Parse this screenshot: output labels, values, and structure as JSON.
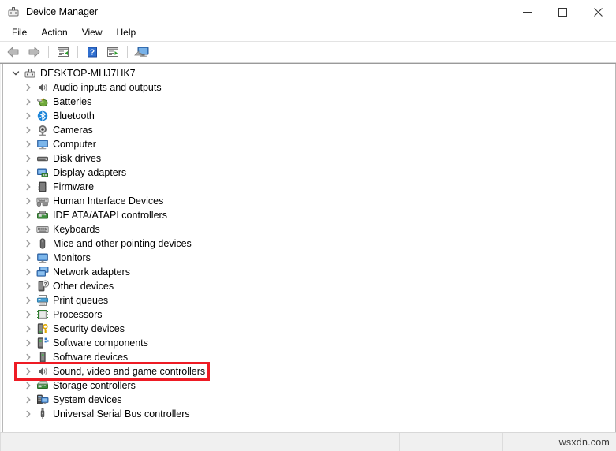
{
  "window": {
    "title": "Device Manager",
    "title_icon": "device-manager-icon",
    "controls": {
      "minimize": "minimize-icon",
      "maximize": "maximize-icon",
      "close": "close-icon"
    }
  },
  "menubar": {
    "items": [
      {
        "label": "File",
        "name": "menu-file"
      },
      {
        "label": "Action",
        "name": "menu-action"
      },
      {
        "label": "View",
        "name": "menu-view"
      },
      {
        "label": "Help",
        "name": "menu-help"
      }
    ]
  },
  "toolbar": {
    "buttons": [
      {
        "name": "back-button",
        "icon": "back-arrow-icon"
      },
      {
        "name": "forward-button",
        "icon": "forward-arrow-icon"
      },
      {
        "name": "properties-button",
        "icon": "properties-icon"
      },
      {
        "name": "help-button",
        "icon": "help-icon"
      },
      {
        "name": "update-driver-button",
        "icon": "update-driver-icon"
      },
      {
        "name": "scan-hardware-changes-button",
        "icon": "scan-hardware-icon"
      }
    ]
  },
  "tree": {
    "root": {
      "label": "DESKTOP-MHJ7HK7",
      "icon": "computer-root-icon",
      "expanded": true
    },
    "items": [
      {
        "label": "Audio inputs and outputs",
        "icon": "speaker-icon"
      },
      {
        "label": "Batteries",
        "icon": "battery-icon"
      },
      {
        "label": "Bluetooth",
        "icon": "bluetooth-icon"
      },
      {
        "label": "Cameras",
        "icon": "camera-icon"
      },
      {
        "label": "Computer",
        "icon": "monitor-icon"
      },
      {
        "label": "Disk drives",
        "icon": "disk-drive-icon"
      },
      {
        "label": "Display adapters",
        "icon": "display-adapter-icon"
      },
      {
        "label": "Firmware",
        "icon": "firmware-chip-icon"
      },
      {
        "label": "Human Interface Devices",
        "icon": "hid-icon"
      },
      {
        "label": "IDE ATA/ATAPI controllers",
        "icon": "ide-controller-icon"
      },
      {
        "label": "Keyboards",
        "icon": "keyboard-icon"
      },
      {
        "label": "Mice and other pointing devices",
        "icon": "mouse-icon"
      },
      {
        "label": "Monitors",
        "icon": "monitor-icon"
      },
      {
        "label": "Network adapters",
        "icon": "network-adapter-icon"
      },
      {
        "label": "Other devices",
        "icon": "other-device-icon"
      },
      {
        "label": "Print queues",
        "icon": "printer-icon"
      },
      {
        "label": "Processors",
        "icon": "processor-icon"
      },
      {
        "label": "Security devices",
        "icon": "security-device-icon"
      },
      {
        "label": "Software components",
        "icon": "software-component-icon"
      },
      {
        "label": "Software devices",
        "icon": "software-device-icon"
      },
      {
        "label": "Sound, video and game controllers",
        "icon": "speaker-icon",
        "highlighted": true
      },
      {
        "label": "Storage controllers",
        "icon": "storage-controller-icon"
      },
      {
        "label": "System devices",
        "icon": "system-device-icon"
      },
      {
        "label": "Universal Serial Bus controllers",
        "icon": "usb-icon"
      }
    ]
  },
  "statusbar": {
    "text": "",
    "watermark": "wsxdn.com"
  },
  "colors": {
    "highlight_border": "#ee1b24",
    "accent_blue": "#0078d7"
  }
}
